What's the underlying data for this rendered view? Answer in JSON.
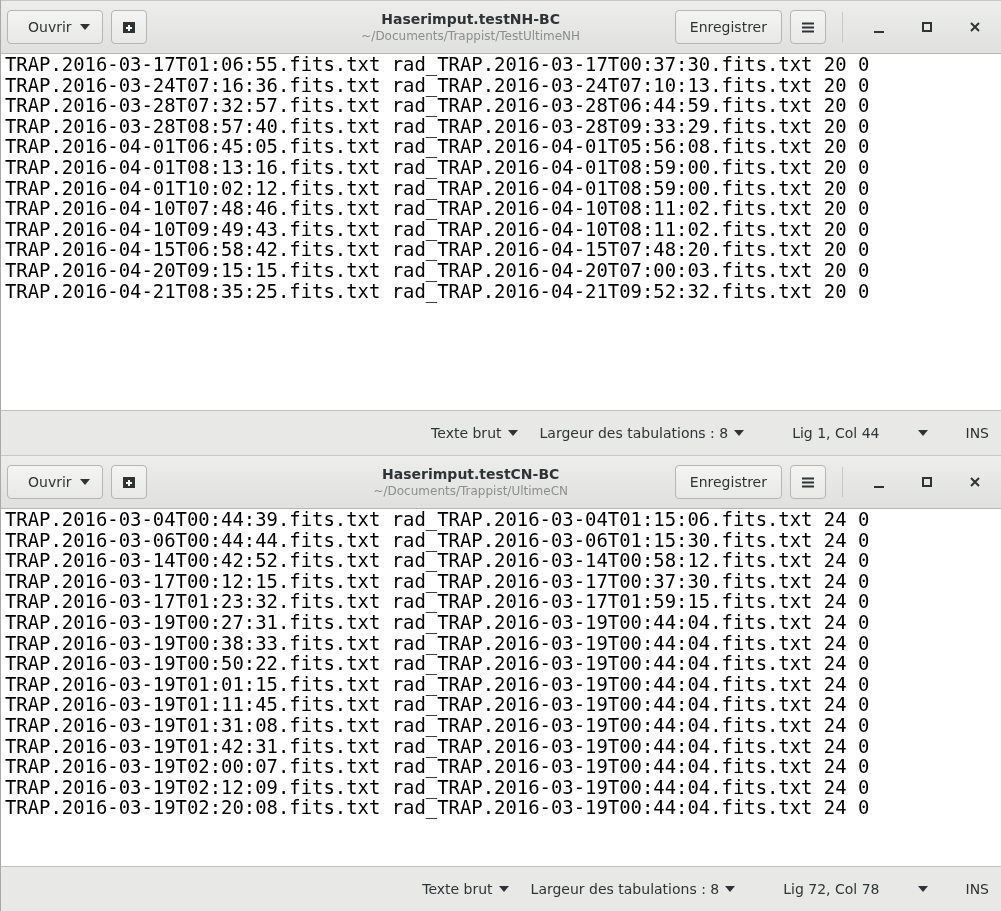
{
  "windows": [
    {
      "title": "Haserimput.testNH-BC",
      "subtitle": "~/Documents/Trappist/TestUltimeNH",
      "open_label": "Ouvrir",
      "save_label": "Enregistrer",
      "lines": [
        "TRAP.2016-03-17T01:06:55.fits.txt rad_TRAP.2016-03-17T00:37:30.fits.txt 20 0",
        "TRAP.2016-03-24T07:16:36.fits.txt rad_TRAP.2016-03-24T07:10:13.fits.txt 20 0",
        "TRAP.2016-03-28T07:32:57.fits.txt rad_TRAP.2016-03-28T06:44:59.fits.txt 20 0",
        "TRAP.2016-03-28T08:57:40.fits.txt rad_TRAP.2016-03-28T09:33:29.fits.txt 20 0",
        "TRAP.2016-04-01T06:45:05.fits.txt rad_TRAP.2016-04-01T05:56:08.fits.txt 20 0",
        "TRAP.2016-04-01T08:13:16.fits.txt rad_TRAP.2016-04-01T08:59:00.fits.txt 20 0",
        "TRAP.2016-04-01T10:02:12.fits.txt rad_TRAP.2016-04-01T08:59:00.fits.txt 20 0",
        "TRAP.2016-04-10T07:48:46.fits.txt rad_TRAP.2016-04-10T08:11:02.fits.txt 20 0",
        "TRAP.2016-04-10T09:49:43.fits.txt rad_TRAP.2016-04-10T08:11:02.fits.txt 20 0",
        "TRAP.2016-04-15T06:58:42.fits.txt rad_TRAP.2016-04-15T07:48:20.fits.txt 20 0",
        "TRAP.2016-04-20T09:15:15.fits.txt rad_TRAP.2016-04-20T07:00:03.fits.txt 20 0",
        "TRAP.2016-04-21T08:35:25.fits.txt rad_TRAP.2016-04-21T09:52:32.fits.txt 20 0"
      ],
      "status": {
        "language": "Texte brut",
        "tab_width": "Largeur des tabulations : 8",
        "position": "Lig 1, Col 44",
        "mode": "INS"
      }
    },
    {
      "title": "Haserimput.testCN-BC",
      "subtitle": "~/Documents/Trappist/UltimeCN",
      "open_label": "Ouvrir",
      "save_label": "Enregistrer",
      "lines": [
        "TRAP.2016-03-04T00:44:39.fits.txt rad_TRAP.2016-03-04T01:15:06.fits.txt 24 0",
        "TRAP.2016-03-06T00:44:44.fits.txt rad_TRAP.2016-03-06T01:15:30.fits.txt 24 0",
        "TRAP.2016-03-14T00:42:52.fits.txt rad_TRAP.2016-03-14T00:58:12.fits.txt 24 0",
        "TRAP.2016-03-17T00:12:15.fits.txt rad_TRAP.2016-03-17T00:37:30.fits.txt 24 0",
        "TRAP.2016-03-17T01:23:32.fits.txt rad_TRAP.2016-03-17T01:59:15.fits.txt 24 0",
        "TRAP.2016-03-19T00:27:31.fits.txt rad_TRAP.2016-03-19T00:44:04.fits.txt 24 0",
        "TRAP.2016-03-19T00:38:33.fits.txt rad_TRAP.2016-03-19T00:44:04.fits.txt 24 0",
        "TRAP.2016-03-19T00:50:22.fits.txt rad_TRAP.2016-03-19T00:44:04.fits.txt 24 0",
        "TRAP.2016-03-19T01:01:15.fits.txt rad_TRAP.2016-03-19T00:44:04.fits.txt 24 0",
        "TRAP.2016-03-19T01:11:45.fits.txt rad_TRAP.2016-03-19T00:44:04.fits.txt 24 0",
        "TRAP.2016-03-19T01:31:08.fits.txt rad_TRAP.2016-03-19T00:44:04.fits.txt 24 0",
        "TRAP.2016-03-19T01:42:31.fits.txt rad_TRAP.2016-03-19T00:44:04.fits.txt 24 0",
        "TRAP.2016-03-19T02:00:07.fits.txt rad_TRAP.2016-03-19T00:44:04.fits.txt 24 0",
        "TRAP.2016-03-19T02:12:09.fits.txt rad_TRAP.2016-03-19T00:44:04.fits.txt 24 0",
        "TRAP.2016-03-19T02:20:08.fits.txt rad_TRAP.2016-03-19T00:44:04.fits.txt 24 0"
      ],
      "status": {
        "language": "Texte brut",
        "tab_width": "Largeur des tabulations : 8",
        "position": "Lig 72, Col 78",
        "mode": "INS"
      }
    }
  ]
}
